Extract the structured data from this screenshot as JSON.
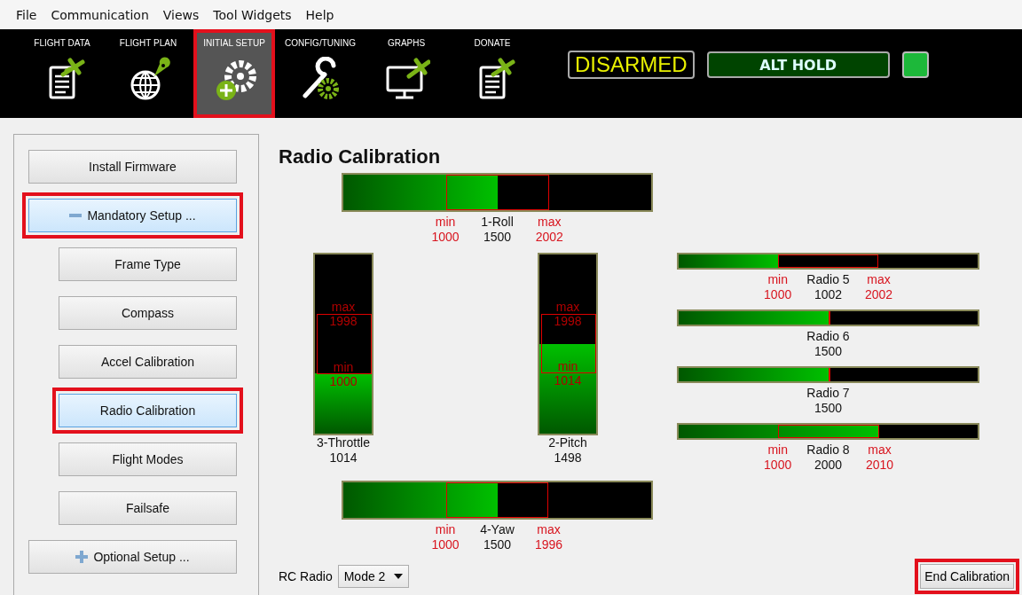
{
  "menu": [
    "File",
    "Communication",
    "Views",
    "Tool Widgets",
    "Help"
  ],
  "nav": [
    {
      "label": "FLIGHT DATA",
      "selected": false,
      "highlighted": false
    },
    {
      "label": "FLIGHT PLAN",
      "selected": false,
      "highlighted": false
    },
    {
      "label": "INITIAL SETUP",
      "selected": true,
      "highlighted": true
    },
    {
      "label": "CONFIG/TUNING",
      "selected": false,
      "highlighted": false
    },
    {
      "label": "GRAPHS",
      "selected": false,
      "highlighted": false
    },
    {
      "label": "DONATE",
      "selected": false,
      "highlighted": false
    }
  ],
  "status": {
    "arm": "DISARMED",
    "mode": "ALT HOLD"
  },
  "sidebar": [
    {
      "label": "Install Firmware",
      "kind": "top",
      "selected": false,
      "highlighted": false
    },
    {
      "label": "Mandatory Setup ...",
      "kind": "group",
      "expanded": true,
      "selected": true,
      "highlighted": true
    },
    {
      "label": "Frame Type",
      "kind": "sub",
      "selected": false,
      "highlighted": false
    },
    {
      "label": "Compass",
      "kind": "sub",
      "selected": false,
      "highlighted": false
    },
    {
      "label": "Accel Calibration",
      "kind": "sub",
      "selected": false,
      "highlighted": false
    },
    {
      "label": "Radio Calibration",
      "kind": "sub",
      "selected": true,
      "highlighted": true
    },
    {
      "label": "Flight Modes",
      "kind": "sub",
      "selected": false,
      "highlighted": false
    },
    {
      "label": "Failsafe",
      "kind": "sub",
      "selected": false,
      "highlighted": false
    },
    {
      "label": "Optional Setup ...",
      "kind": "group",
      "expanded": false,
      "selected": false,
      "highlighted": false
    }
  ],
  "title": "Radio Calibration",
  "roll": {
    "name": "1-Roll",
    "value": "1500",
    "min_label": "min",
    "min": "1000",
    "max_label": "max",
    "max": "2002",
    "level": 0.5
  },
  "throttle": {
    "name": "3-Throttle",
    "value": "1014",
    "min_label": "min",
    "min": "1000",
    "max_label": "max",
    "max": "1998",
    "level": 0.338
  },
  "pitch": {
    "name": "2-Pitch",
    "value": "1498",
    "min_label": "min",
    "min": "1014",
    "max_label": "max",
    "max": "1998",
    "level": 0.499
  },
  "radios": [
    {
      "name": "Radio 5",
      "value": "1002",
      "min_label": "min",
      "min": "1000",
      "max_label": "max",
      "max": "2002",
      "level": 0.334
    },
    {
      "name": "Radio 6",
      "value": "1500",
      "level": 0.5
    },
    {
      "name": "Radio 7",
      "value": "1500",
      "level": 0.5
    },
    {
      "name": "Radio 8",
      "value": "2000",
      "min_label": "min",
      "min": "1000",
      "max_label": "max",
      "max": "2010",
      "level": 0.667
    }
  ],
  "yaw": {
    "name": "4-Yaw",
    "value": "1500",
    "min_label": "min",
    "min": "1000",
    "max_label": "max",
    "max": "1996",
    "level": 0.5
  },
  "rc_radio": {
    "label": "RC Radio",
    "value": "Mode 2"
  },
  "end_button": {
    "label": "End Calibration",
    "highlighted": true
  }
}
